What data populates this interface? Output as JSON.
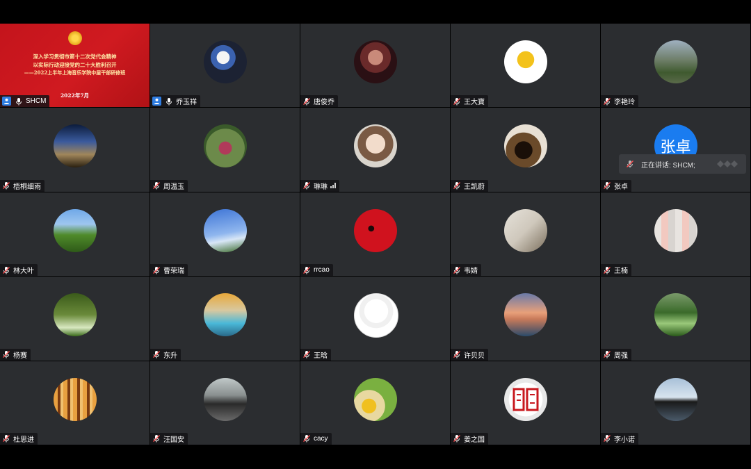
{
  "banner": {
    "line1": "深入学习贯彻市第十二次党代会精神",
    "line2": "以实际行动迎接党的二十大胜利召开",
    "line3": "——2022上半年上海音乐学院中层干部研修班",
    "date": "2022年7月"
  },
  "speaking": {
    "text": "正在讲话: SHCM;"
  },
  "colors": {
    "active_border": "#2ecc40",
    "tile_bg": "#2b2d30",
    "banner_red": "#c8161d",
    "avatar_blue": "#1a7cf0"
  },
  "participants": [
    {
      "name": "SHCM",
      "icon": "person-icon",
      "active": true
    },
    {
      "name": "乔玉祥",
      "icon": "person-icon"
    },
    {
      "name": "唐俊乔",
      "icon": "mic-muted-icon"
    },
    {
      "name": "王大寶",
      "icon": "mic-muted-icon"
    },
    {
      "name": "李艳玲",
      "icon": "mic-muted-icon"
    },
    {
      "name": "梧桐细雨",
      "icon": "mic-muted-icon"
    },
    {
      "name": "周温玉",
      "icon": "mic-muted-icon"
    },
    {
      "name": "琳琳",
      "icon": "mic-muted-icon",
      "signal": true
    },
    {
      "name": "王凯蔚",
      "icon": "mic-muted-icon"
    },
    {
      "name": "张卓",
      "icon": "mic-muted-icon",
      "avatar_text": "张卓"
    },
    {
      "name": "林大叶",
      "icon": "mic-muted-icon"
    },
    {
      "name": "曹荣瑞",
      "icon": "mic-muted-icon"
    },
    {
      "name": "rrcao",
      "icon": "mic-muted-icon"
    },
    {
      "name": "韦婧",
      "icon": "mic-muted-icon"
    },
    {
      "name": "王楠",
      "icon": "mic-muted-icon"
    },
    {
      "name": "杨赛",
      "icon": "mic-muted-icon"
    },
    {
      "name": "东升",
      "icon": "mic-muted-icon"
    },
    {
      "name": "王晗",
      "icon": "mic-muted-icon"
    },
    {
      "name": "许贝贝",
      "icon": "mic-muted-icon"
    },
    {
      "name": "周强",
      "icon": "mic-muted-icon"
    },
    {
      "name": "杜思进",
      "icon": "mic-muted-icon"
    },
    {
      "name": "汪国安",
      "icon": "mic-muted-icon"
    },
    {
      "name": "cacy",
      "icon": "mic-muted-icon"
    },
    {
      "name": "姜之国",
      "icon": "mic-muted-icon"
    },
    {
      "name": "李小诺",
      "icon": "mic-muted-icon"
    }
  ]
}
